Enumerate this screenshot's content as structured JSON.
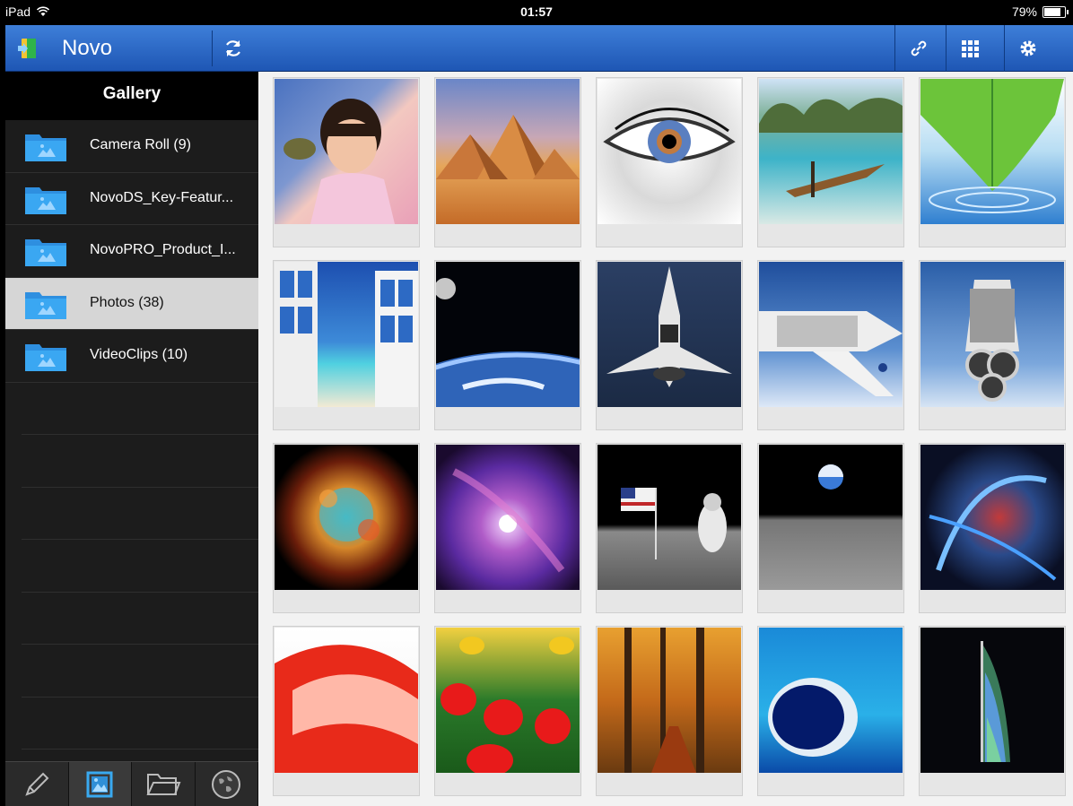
{
  "status": {
    "device": "iPad",
    "time": "01:57",
    "battery": "79%",
    "battery_level": 0.79
  },
  "app": {
    "title": "Novo"
  },
  "gallery": {
    "title": "Gallery"
  },
  "folders": [
    {
      "label": "Camera Roll (9)"
    },
    {
      "label": "NovoDS_Key-Featur..."
    },
    {
      "label": "NovoPRO_Product_I..."
    },
    {
      "label": "Photos (38)"
    },
    {
      "label": "VideoClips (10)"
    }
  ],
  "selected_folder": "Photos (38)",
  "tabs": [
    "pencil-icon",
    "gallery-icon",
    "folder-icon",
    "globe-icon"
  ],
  "header_buttons": [
    "link-icon",
    "grid-view-icon",
    "settings-icon"
  ],
  "colors": {
    "header_blue": "#2a66c4",
    "sidebar": "#1c1c1c",
    "selected_row": "#d6d6d6",
    "accent": "#39a9f0"
  },
  "photos": [
    {
      "name": "child-portrait"
    },
    {
      "name": "pyramids"
    },
    {
      "name": "eye"
    },
    {
      "name": "tropical-boat"
    },
    {
      "name": "leaf-water"
    },
    {
      "name": "window-beach"
    },
    {
      "name": "earth-moon"
    },
    {
      "name": "shuttle-front"
    },
    {
      "name": "shuttle-bay"
    },
    {
      "name": "shuttle-engines"
    },
    {
      "name": "crab-nebula"
    },
    {
      "name": "pink-nebula"
    },
    {
      "name": "moon-landing"
    },
    {
      "name": "earthrise"
    },
    {
      "name": "abstract-swirl"
    },
    {
      "name": "strawberry"
    },
    {
      "name": "tulips"
    },
    {
      "name": "autumn-forest"
    },
    {
      "name": "blue-hole"
    },
    {
      "name": "burj-al-arab"
    }
  ]
}
